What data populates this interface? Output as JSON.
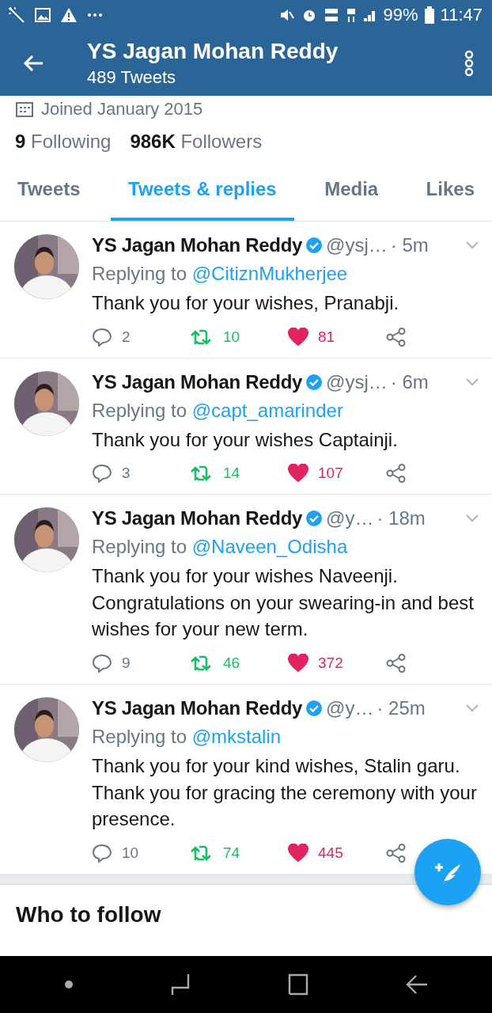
{
  "status_bar": {
    "battery": "99%",
    "time": "11:47"
  },
  "header": {
    "title": "YS Jagan Mohan Reddy",
    "subtitle": "489 Tweets"
  },
  "profile": {
    "joined": "Joined January 2015",
    "following_count": "9",
    "following_label": "Following",
    "followers_count": "986K",
    "followers_label": "Followers"
  },
  "tabs": [
    {
      "label": "Tweets",
      "selected": false
    },
    {
      "label": "Tweets & replies",
      "selected": true
    },
    {
      "label": "Media",
      "selected": false
    },
    {
      "label": "Likes",
      "selected": false
    }
  ],
  "tweets": [
    {
      "name": "YS Jagan Mohan Reddy",
      "verified": true,
      "handle": "@ysj…",
      "time": "· 5m",
      "replying_label": "Replying to",
      "replying_to": "@CitiznMukherjee",
      "text": "Thank you for your wishes, Pranabji.",
      "replies": "2",
      "retweets": "10",
      "retweeted": true,
      "likes": "81",
      "liked": true
    },
    {
      "name": "YS Jagan Mohan Reddy",
      "verified": true,
      "handle": "@ysj…",
      "time": "· 6m",
      "replying_label": "Replying to",
      "replying_to": "@capt_amarinder",
      "text": "Thank you for your wishes Captainji.",
      "replies": "3",
      "retweets": "14",
      "retweeted": true,
      "likes": "107",
      "liked": true
    },
    {
      "name": "YS Jagan Mohan Reddy",
      "verified": true,
      "handle": "@y…",
      "time": "· 18m",
      "replying_label": "Replying to",
      "replying_to": "@Naveen_Odisha",
      "text": "Thank you for your wishes Naveenji. Congratulations on your swearing-in and best wishes for your new term.",
      "replies": "9",
      "retweets": "46",
      "retweeted": true,
      "likes": "372",
      "liked": true
    },
    {
      "name": "YS Jagan Mohan Reddy",
      "verified": true,
      "handle": "@y…",
      "time": "· 25m",
      "replying_label": "Replying to",
      "replying_to": "@mkstalin",
      "text": "Thank you for your kind wishes, Stalin garu. Thank you for gracing the ceremony with your presence.",
      "replies": "10",
      "retweets": "74",
      "retweeted": true,
      "likes": "445",
      "liked": true
    }
  ],
  "section_title": "Who to follow"
}
